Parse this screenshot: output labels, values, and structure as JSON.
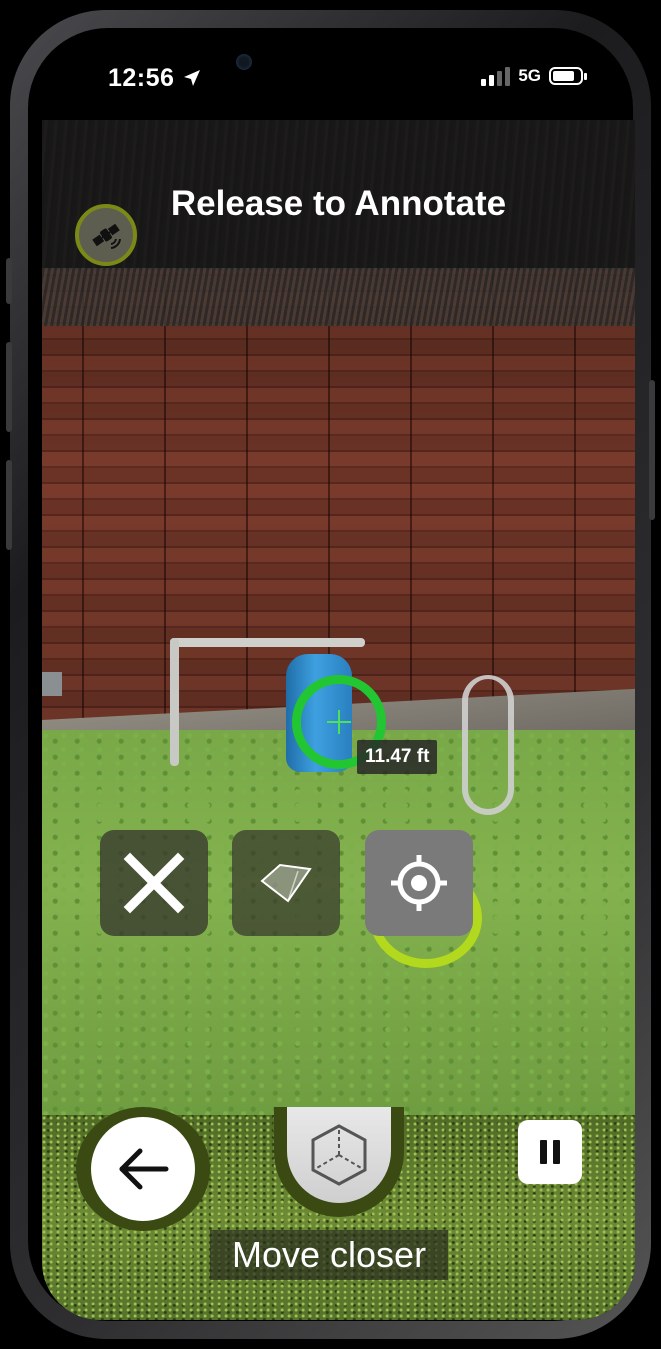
{
  "status_bar": {
    "time": "12:56",
    "network": "5G",
    "location_icon": "location-arrow-icon",
    "battery_level": 0.8
  },
  "header": {
    "title": "Release to Annotate",
    "gps_icon": "satellite-icon",
    "accent_color": "#7b8a16"
  },
  "measurement": {
    "distance": "11.47 ft",
    "reticle_color": "#22c532"
  },
  "toolbar": {
    "close_icon": "close-icon",
    "plane_icon": "plane-icon",
    "target_icon": "crosshair-target-icon",
    "halo_color": "#b6dc1c"
  },
  "bottom_controls": {
    "back_icon": "arrow-left-icon",
    "cube_icon": "cube-axes-icon",
    "pause_icon": "pause-icon",
    "hint": "Move closer"
  }
}
